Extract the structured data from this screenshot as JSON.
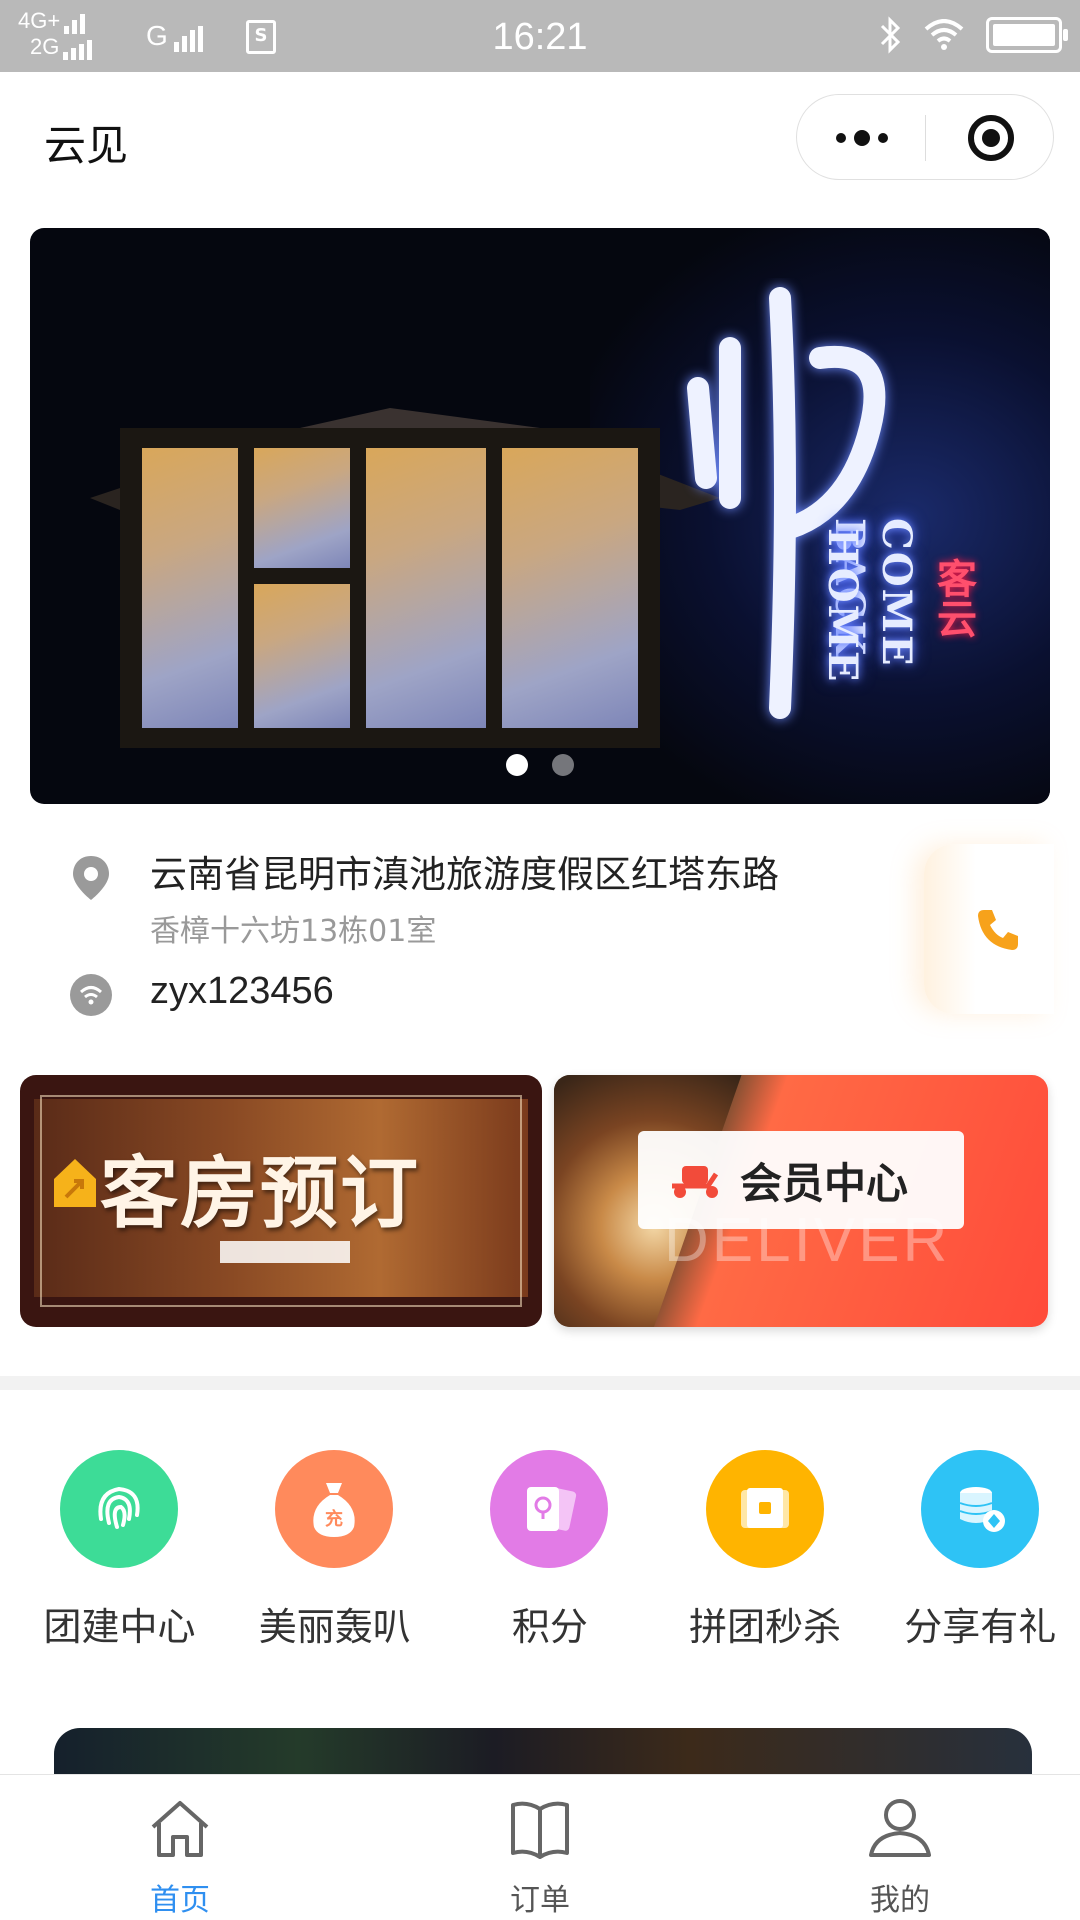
{
  "status_bar": {
    "network_top": "4G+",
    "network_bottom": "2G",
    "carrier_g": "G",
    "sim_label": "S",
    "time": "16:21"
  },
  "navbar": {
    "title": "云见"
  },
  "banner": {
    "neon_line1": "COME BACK",
    "neon_line2": "HOME",
    "neon_red": "客云",
    "slide_count": 2,
    "active_slide": 1
  },
  "info": {
    "address_line1": "云南省昆明市滇池旅游度假区红塔东路",
    "address_line2": "香樟十六坊13栋01室",
    "wifi": "zyx123456"
  },
  "promos": {
    "left_title": "客房预订",
    "right_label": "会员中心",
    "right_watermark": "DELIVER"
  },
  "shortcuts": [
    {
      "label": "团建中心",
      "icon": "fingerprint-icon",
      "color": "#3ddc97"
    },
    {
      "label": "美丽轰叭",
      "icon": "money-bag-icon",
      "color": "#ff8a5c"
    },
    {
      "label": "积分",
      "icon": "points-card-icon",
      "color": "#e27be6"
    },
    {
      "label": "拼团秒杀",
      "icon": "ticket-icon",
      "color": "#ffb400"
    },
    {
      "label": "分享有礼",
      "icon": "coins-gift-icon",
      "color": "#2ec3f5"
    }
  ],
  "tabbar": {
    "items": [
      {
        "label": "首页",
        "icon": "home-icon",
        "active": true
      },
      {
        "label": "订单",
        "icon": "book-icon",
        "active": false
      },
      {
        "label": "我的",
        "icon": "user-icon",
        "active": false
      }
    ]
  },
  "colors": {
    "accent": "#2f8ff0",
    "phone": "#f7a21b"
  }
}
